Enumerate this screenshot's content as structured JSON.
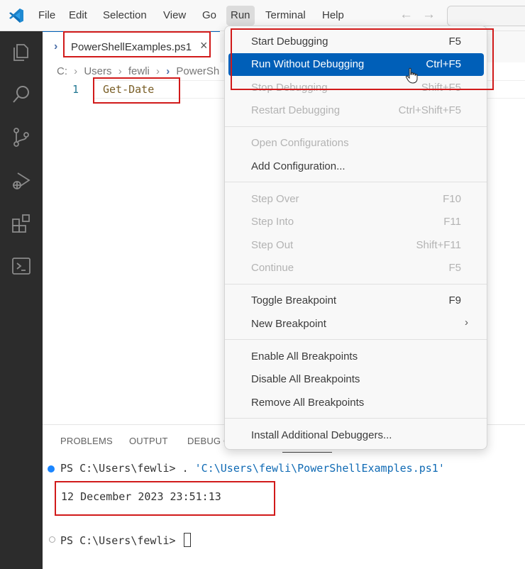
{
  "menubar": {
    "items": [
      "File",
      "Edit",
      "Selection",
      "View",
      "Go",
      "Run",
      "Terminal",
      "Help"
    ],
    "back_arrow": "←",
    "forward_arrow": "→"
  },
  "editor": {
    "tab": {
      "label": "PowerShellExamples.ps1",
      "close": "×",
      "icon": "›"
    },
    "breadcrumb": [
      "C:",
      "Users",
      "fewli",
      "PowerSh"
    ],
    "lines": [
      {
        "number": "1",
        "code": "Get-Date"
      }
    ]
  },
  "run_menu": {
    "groups": [
      [
        {
          "label": "Start Debugging",
          "shortcut": "F5",
          "enabled": true
        },
        {
          "label": "Run Without Debugging",
          "shortcut": "Ctrl+F5",
          "enabled": true,
          "highlighted": true
        },
        {
          "label": "Stop Debugging",
          "shortcut": "Shift+F5",
          "enabled": false
        },
        {
          "label": "Restart Debugging",
          "shortcut": "Ctrl+Shift+F5",
          "enabled": false
        }
      ],
      [
        {
          "label": "Open Configurations",
          "shortcut": "",
          "enabled": false
        },
        {
          "label": "Add Configuration...",
          "shortcut": "",
          "enabled": true
        }
      ],
      [
        {
          "label": "Step Over",
          "shortcut": "F10",
          "enabled": false
        },
        {
          "label": "Step Into",
          "shortcut": "F11",
          "enabled": false
        },
        {
          "label": "Step Out",
          "shortcut": "Shift+F11",
          "enabled": false
        },
        {
          "label": "Continue",
          "shortcut": "F5",
          "enabled": false
        }
      ],
      [
        {
          "label": "Toggle Breakpoint",
          "shortcut": "F9",
          "enabled": true
        },
        {
          "label": "New Breakpoint",
          "shortcut": "",
          "enabled": true,
          "submenu": "›"
        }
      ],
      [
        {
          "label": "Enable All Breakpoints",
          "shortcut": "",
          "enabled": true
        },
        {
          "label": "Disable All Breakpoints",
          "shortcut": "",
          "enabled": true
        },
        {
          "label": "Remove All Breakpoints",
          "shortcut": "",
          "enabled": true
        }
      ],
      [
        {
          "label": "Install Additional Debuggers...",
          "shortcut": "",
          "enabled": true
        }
      ]
    ]
  },
  "panel": {
    "tabs": [
      "PROBLEMS",
      "OUTPUT",
      "DEBUG C"
    ],
    "terminal": {
      "prompt": "PS C:\\Users\\fewli>",
      "command": ". ",
      "command_path": "'C:\\Users\\fewli\\PowerShellExamples.ps1'",
      "output": "12 December 2023 23:51:13",
      "prompt2": "PS C:\\Users\\fewli>"
    }
  },
  "colors": {
    "accent": "#005fb8",
    "annotation": "#d11a1a",
    "activity_bar": "#2c2c2c"
  }
}
